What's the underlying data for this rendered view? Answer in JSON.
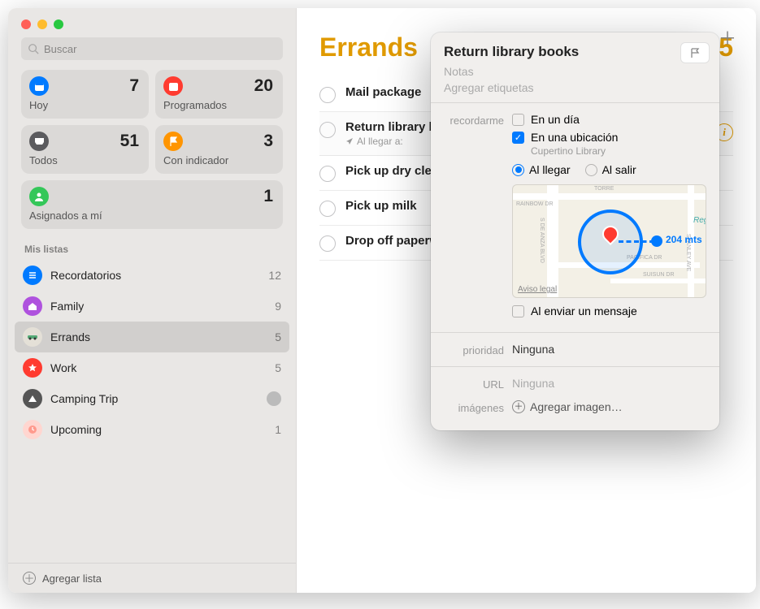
{
  "search": {
    "placeholder": "Buscar"
  },
  "smart_lists": {
    "today": {
      "label": "Hoy",
      "count": "7"
    },
    "scheduled": {
      "label": "Programados",
      "count": "20"
    },
    "all": {
      "label": "Todos",
      "count": "51"
    },
    "flagged": {
      "label": "Con indicador",
      "count": "3"
    },
    "assigned": {
      "label": "Asignados a mí",
      "count": "1"
    }
  },
  "sidebar": {
    "section_title": "Mis listas",
    "lists": [
      {
        "name": "Recordatorios",
        "count": "12"
      },
      {
        "name": "Family",
        "count": "9"
      },
      {
        "name": "Errands",
        "count": "5"
      },
      {
        "name": "Work",
        "count": "5"
      },
      {
        "name": "Camping Trip",
        "count": ""
      },
      {
        "name": "Upcoming",
        "count": "1"
      }
    ],
    "add_list": "Agregar lista"
  },
  "main": {
    "title": "Errands",
    "big_count": "5",
    "tasks": [
      {
        "title": "Mail package",
        "sub": ""
      },
      {
        "title": "Return library books",
        "sub": "Al llegar a:"
      },
      {
        "title": "Pick up dry cleaning",
        "sub": ""
      },
      {
        "title": "Pick up milk",
        "sub": ""
      },
      {
        "title": "Drop off paperwork",
        "sub": ""
      }
    ]
  },
  "popover": {
    "title": "Return library books",
    "notes_placeholder": "Notas",
    "tags_placeholder": "Agregar etiquetas",
    "remind_label": "recordarme",
    "on_day": "En un día",
    "at_location": "En una ubicación",
    "location_name": "Cupertino Library",
    "arriving": "Al llegar",
    "leaving": "Al salir",
    "radius_text": "204 mts",
    "legal": "Aviso legal",
    "when_messaging": "Al enviar un mensaje",
    "priority_label": "prioridad",
    "priority_value": "Ninguna",
    "url_label": "URL",
    "url_value": "Ninguna",
    "images_label": "imágenes",
    "add_image": "Agregar imagen…",
    "map_streets": {
      "torres": "TORRE",
      "rainbow": "RAINBOW DR",
      "anza": "S DE ANZA BLVD",
      "pacifica": "PACIFICA DR",
      "suisun": "SUISUN DR",
      "stanley": "STANLEY AVE",
      "regnart": "Reg"
    }
  }
}
